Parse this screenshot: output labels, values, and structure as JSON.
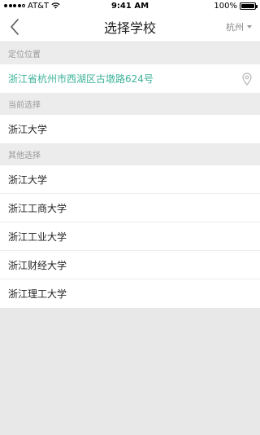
{
  "status": {
    "carrier": "AT&T",
    "time": "9:41 AM",
    "battery": "100%",
    "battery_level": 1.0
  },
  "nav": {
    "title": "选择学校",
    "city": "杭州"
  },
  "location_section": {
    "header": "定位位置",
    "address": "浙江省杭州市西湖区古墩路624号"
  },
  "current_section": {
    "header": "当前选择",
    "school": "浙江大学"
  },
  "other_section": {
    "header": "其他选择",
    "schools": [
      "浙江大学",
      "浙江工商大学",
      "浙江工业大学",
      "浙江财经大学",
      "浙江理工大学"
    ]
  },
  "colors": {
    "accent": "#3db29a",
    "background": "#e8e8e8"
  },
  "icons": {
    "back": "chevron-left-icon",
    "pin": "location-pin-icon",
    "city_caret": "caret-down-icon",
    "wifi": "wifi-icon"
  }
}
